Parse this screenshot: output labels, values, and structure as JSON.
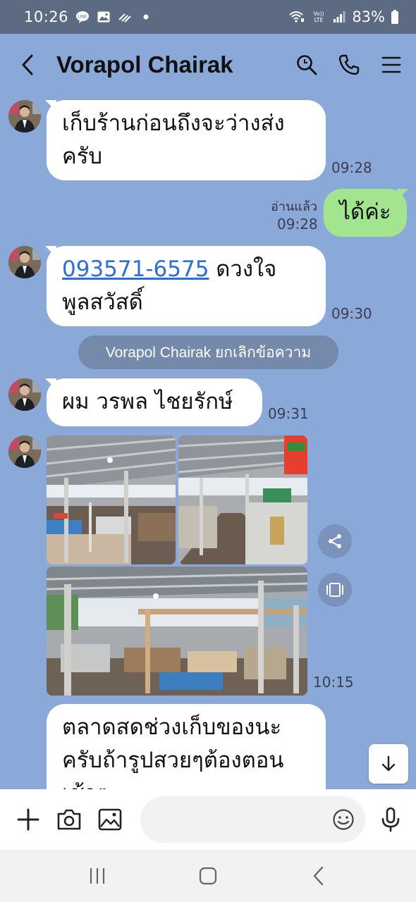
{
  "status_bar": {
    "time": "10:26",
    "battery": "83%"
  },
  "header": {
    "title": "Vorapol Chairak"
  },
  "messages": {
    "m1": {
      "text": "เก็บร้านก่อนถึงจะว่างส่งครับ",
      "line1": "เก็บร้านก่อนถึงจะว่างส่ง",
      "line2": "ครับ",
      "time": "09:28"
    },
    "m2": {
      "text": "ได้ค่ะ",
      "read": "อ่านแล้ว",
      "time": "09:28"
    },
    "m3": {
      "phone": "093571-6575",
      "rest1": " ดวงใจ",
      "line2": "พูลสวัสดิ์",
      "time": "09:30"
    },
    "system": "Vorapol Chairak ยกเลิกข้อความ",
    "m4": {
      "text": "ผม วรพล ไชยรักษ์",
      "time": "09:31"
    },
    "m5": {
      "time": "10:15"
    },
    "m6": {
      "line1": "ตลาดสดช่วงเก็บของนะ",
      "line2": "ครับถ้ารูปสวยๆต้องตอน",
      "line3": "เช้าๆ"
    }
  },
  "input": {
    "placeholder": ""
  },
  "colors": {
    "chat_bg": "#8aa9d8",
    "sent_bubble": "#a3e58f",
    "received_bubble": "#ffffff",
    "link": "#2d6fd6"
  }
}
